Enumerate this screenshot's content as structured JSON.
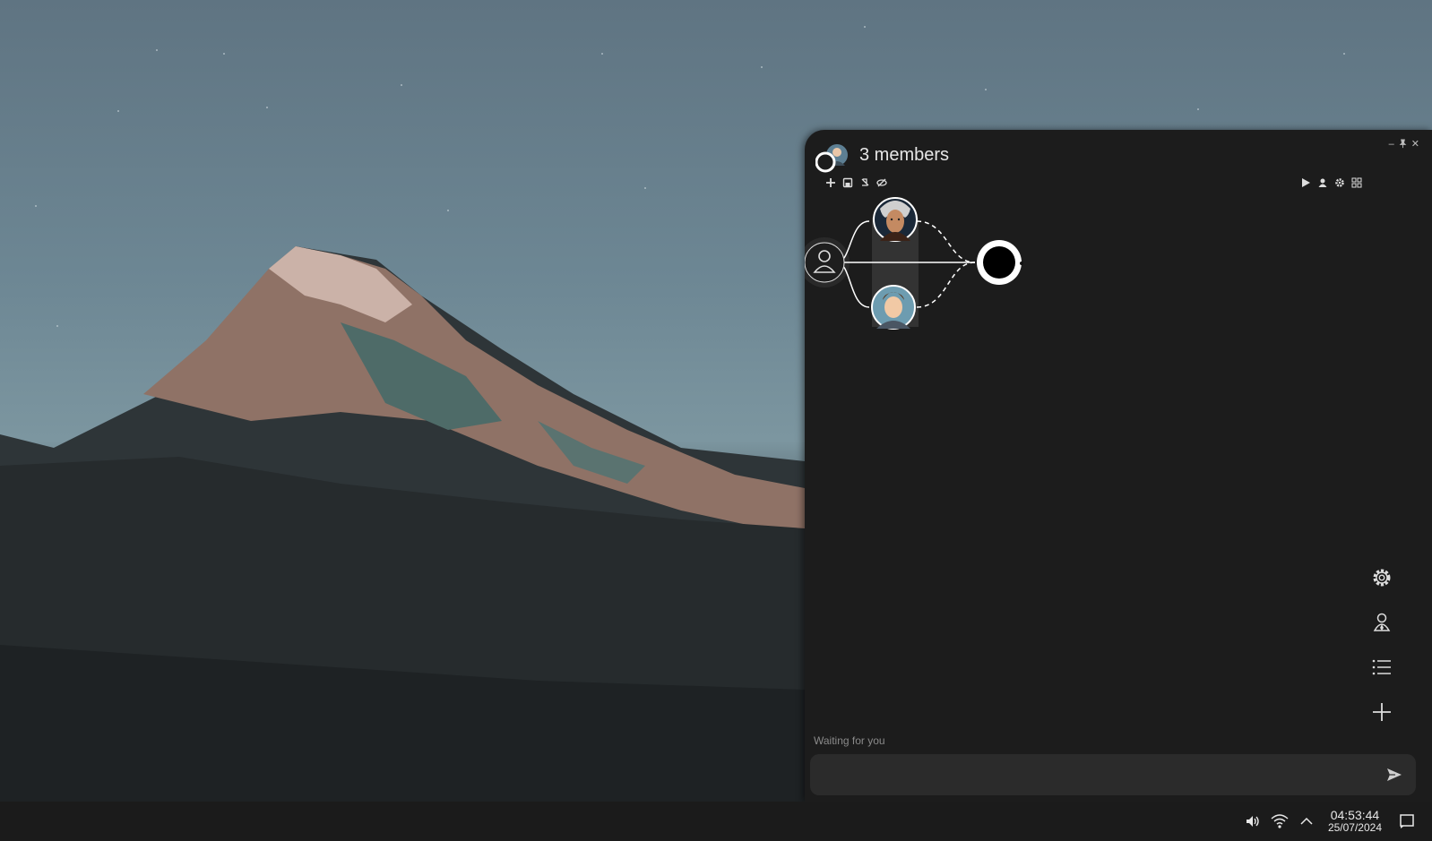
{
  "window": {
    "title": "3 members",
    "controls": {
      "minimize": "–",
      "pin": "📌",
      "close": "✕"
    }
  },
  "toolbar_left": [
    {
      "icon": "plus-icon"
    },
    {
      "icon": "save-icon"
    },
    {
      "icon": "mute-icon"
    },
    {
      "icon": "hide-icon"
    }
  ],
  "toolbar_right": [
    {
      "icon": "play-icon"
    },
    {
      "icon": "user-icon"
    },
    {
      "icon": "gear-icon"
    },
    {
      "icon": "grid-icon"
    }
  ],
  "graph": {
    "nodes": [
      {
        "id": "user",
        "icon": "user-outline-icon"
      },
      {
        "id": "agent-1",
        "icon": "portrait-elderly-man"
      },
      {
        "id": "agent-2",
        "icon": "portrait-young-man"
      },
      {
        "id": "output",
        "icon": "output-node"
      }
    ]
  },
  "side_actions": [
    {
      "icon": "gear-icon"
    },
    {
      "icon": "user-icon"
    },
    {
      "icon": "list-icon"
    },
    {
      "icon": "plus-icon"
    }
  ],
  "status": "Waiting for you",
  "composer": {
    "value": "",
    "placeholder": ""
  },
  "taskbar": {
    "time": "04:53:44",
    "date": "25/07/2024",
    "tray_icons": [
      "volume-icon",
      "wifi-icon",
      "chevron-up-icon",
      "notification-icon"
    ]
  },
  "colors": {
    "window_bg": "#1c1c1c",
    "input_bg": "#2b2b2b",
    "taskbar_bg": "#1b1b1b",
    "text": "#e6e6e6",
    "muted": "#8a8a8a"
  }
}
